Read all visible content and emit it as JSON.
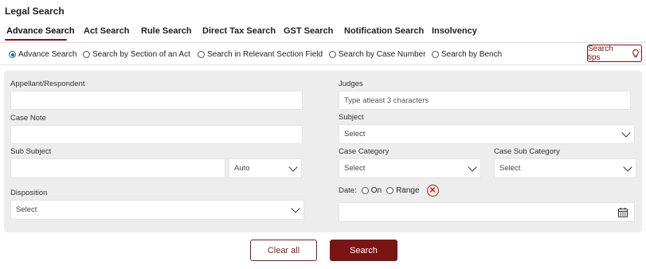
{
  "header": {
    "title": "Legal Search"
  },
  "tabs": [
    {
      "label": "Advance Search",
      "active": true
    },
    {
      "label": "Act Search"
    },
    {
      "label": "Rule Search"
    },
    {
      "label": "Direct Tax Search"
    },
    {
      "label": "GST Search"
    },
    {
      "label": "Notification Search"
    },
    {
      "label": "Insolvency"
    }
  ],
  "search_modes": [
    {
      "label": "Advance Search",
      "checked": true
    },
    {
      "label": "Search by Section of an Act"
    },
    {
      "label": "Search in Relevant Section Field"
    },
    {
      "label": "Search by Case Number"
    },
    {
      "label": "Search by Bench"
    }
  ],
  "search_tips_label": "Search tips",
  "form": {
    "appellant_label": "Appellant/Respondent",
    "appellant_value": "",
    "judges_label": "Judges",
    "judges_placeholder": "Type atleast 3 characters",
    "case_note_label": "Case Note",
    "case_note_value": "",
    "subject_label": "Subject",
    "subject_value": "Select",
    "sub_subject_label": "Sub Subject",
    "sub_subject_value": "",
    "sub_subject_mode": "Auto",
    "case_category_label": "Case Category",
    "case_category_value": "Select",
    "case_sub_category_label": "Case Sub Category",
    "case_sub_category_value": "Select",
    "disposition_label": "Disposition",
    "disposition_value": "Select",
    "date_label": "Date:",
    "date_on_label": "On",
    "date_range_label": "Range",
    "date_value": ""
  },
  "actions": {
    "clear_label": "Clear all",
    "search_label": "Search"
  },
  "colors": {
    "accent": "#7b1515",
    "panel_bg": "#ededed",
    "radio_checked": "#1f5fbf"
  },
  "icons": [
    "lightbulb-icon",
    "clear-date-icon",
    "calendar-icon",
    "chevron-down-icon"
  ]
}
